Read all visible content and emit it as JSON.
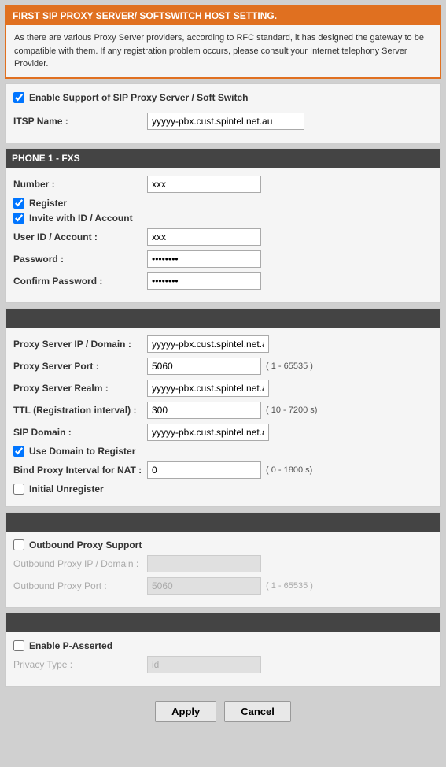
{
  "header": {
    "title": "FIRST SIP PROXY SERVER/ SOFTSWITCH HOST SETTING.",
    "description": "As there are various Proxy Server providers, according to RFC standard, it has designed the gateway to be compatible with them. If any registration problem occurs, please consult your Internet telephony Server Provider."
  },
  "sip_proxy": {
    "enable_label": "Enable Support of SIP Proxy Server / Soft Switch",
    "itsp_label": "ITSP Name :",
    "itsp_value": "yyyyy-pbx.cust.spintel.net.au"
  },
  "phone1": {
    "section_title": "PHONE 1 - FXS",
    "number_label": "Number :",
    "number_value": "xxx",
    "register_label": "Register",
    "invite_label": "Invite with ID / Account",
    "userid_label": "User ID / Account :",
    "userid_value": "xxx",
    "password_label": "Password :",
    "password_value": "••••••••",
    "confirm_label": "Confirm Password :",
    "confirm_value": "••••••••"
  },
  "proxy_settings": {
    "section_title": "",
    "proxy_ip_label": "Proxy Server IP / Domain :",
    "proxy_ip_value": "yyyyy-pbx.cust.spintel.net.au",
    "proxy_port_label": "Proxy Server Port :",
    "proxy_port_value": "5060",
    "proxy_port_hint": "( 1 - 65535 )",
    "proxy_realm_label": "Proxy Server Realm :",
    "proxy_realm_value": "yyyyy-pbx.cust.spintel.net.au",
    "ttl_label": "TTL (Registration interval) :",
    "ttl_value": "300",
    "ttl_hint": "( 10 - 7200 s)",
    "sip_domain_label": "SIP Domain :",
    "sip_domain_value": "yyyyy-pbx.cust.spintel.net.au",
    "use_domain_label": "Use Domain to Register",
    "bind_label": "Bind Proxy Interval for NAT :",
    "bind_value": "0",
    "bind_hint": "( 0 - 1800 s)",
    "initial_unreg_label": "Initial Unregister"
  },
  "outbound_proxy": {
    "support_label": "Outbound Proxy Support",
    "ip_label": "Outbound Proxy IP / Domain :",
    "ip_value": "",
    "port_label": "Outbound Proxy Port :",
    "port_value": "5060",
    "port_hint": "( 1 - 65535 )"
  },
  "p_asserted": {
    "enable_label": "Enable P-Asserted",
    "privacy_label": "Privacy Type :",
    "privacy_value": "id"
  },
  "buttons": {
    "apply": "Apply",
    "cancel": "Cancel"
  }
}
